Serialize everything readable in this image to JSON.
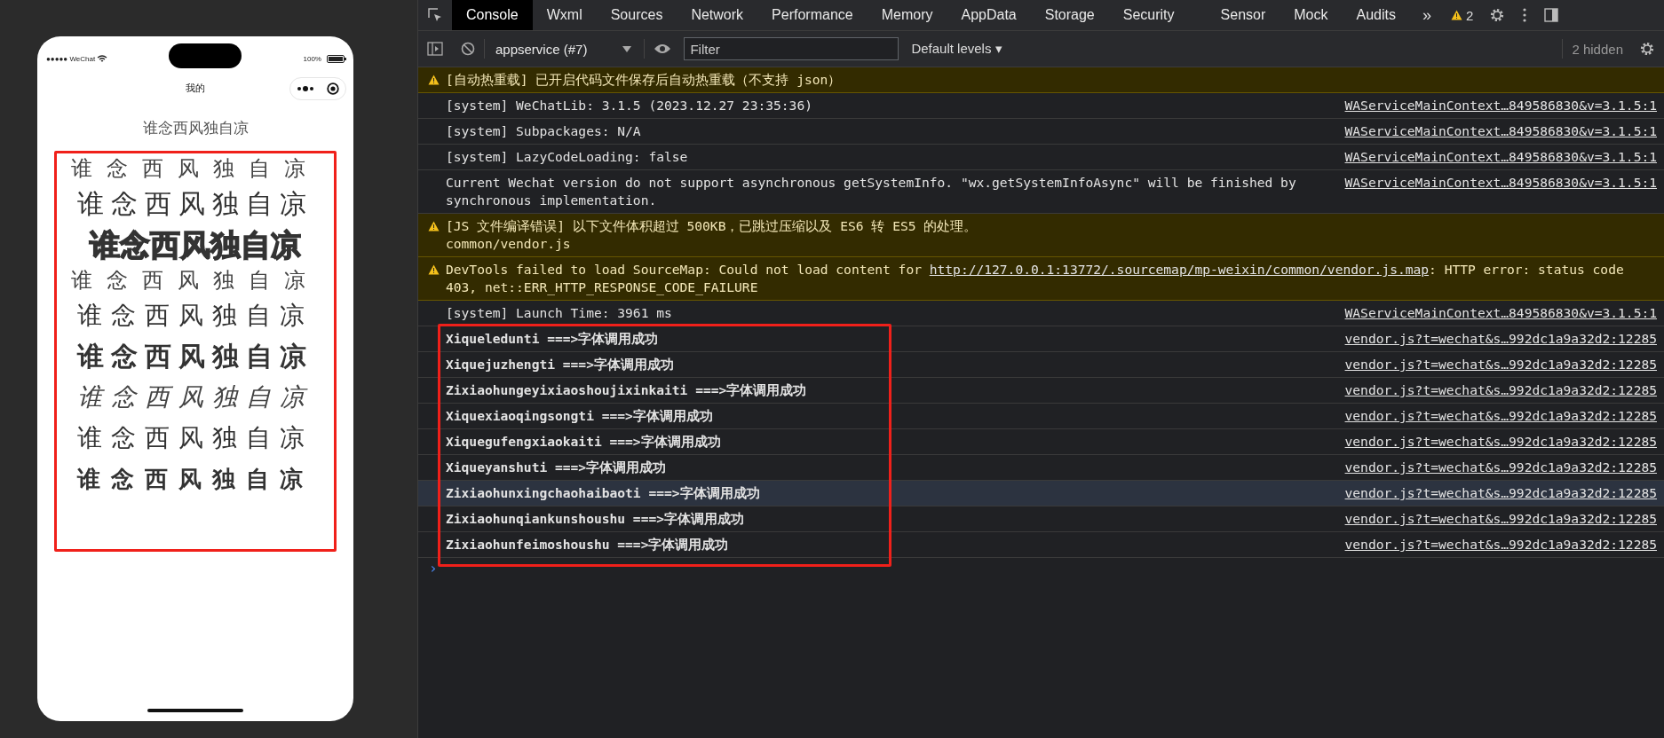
{
  "phone": {
    "status_bar": {
      "carrier": "●●●●● WeChat",
      "battery": "100%"
    },
    "nav_title": "我的",
    "page_title": "谁念西风独自凉",
    "samples": [
      {
        "text": "谁念西风独自凉",
        "kind": "thin"
      },
      {
        "text": "谁念西风独自凉",
        "kind": "song"
      },
      {
        "text": "谁念西风独自凉",
        "kind": "heavy"
      },
      {
        "text": "谁念西风独自凉",
        "kind": "thin"
      },
      {
        "text": "谁念西风独自凉",
        "kind": "kai"
      },
      {
        "text": "谁念西风独自凉",
        "kind": "brush"
      },
      {
        "text": "谁念西风独自凉",
        "kind": "script"
      },
      {
        "text": "谁念西风独自凉",
        "kind": "kai"
      },
      {
        "text": "谁念西风独自凉",
        "kind": "bold"
      }
    ]
  },
  "devtools": {
    "tabs": [
      {
        "label": "Console",
        "selected": true
      },
      {
        "label": "Wxml",
        "selected": false
      },
      {
        "label": "Sources",
        "selected": false
      },
      {
        "label": "Network",
        "selected": false
      },
      {
        "label": "Performance",
        "selected": false
      },
      {
        "label": "Memory",
        "selected": false
      },
      {
        "label": "AppData",
        "selected": false
      },
      {
        "label": "Storage",
        "selected": false
      },
      {
        "label": "Security",
        "selected": false
      },
      {
        "label": "Sensor",
        "selected": false
      },
      {
        "label": "Mock",
        "selected": false
      },
      {
        "label": "Audits",
        "selected": false
      }
    ],
    "more_tabs": "»",
    "warning_count": "2",
    "toolbar": {
      "context": "appservice (#7)",
      "filter_placeholder": "Filter",
      "levels": "Default levels ▾",
      "hidden": "2 hidden"
    },
    "entries": [
      {
        "kind": "warning",
        "highlighted": false,
        "text": "[自动热重载] 已开启代码文件保存后自动热重载（不支持 json）"
      },
      {
        "kind": "log",
        "highlighted": false,
        "text": "[system] WeChatLib: 3.1.5 (2023.12.27 23:35:36)",
        "source": "WAServiceMainContext…849586830&v=3.1.5:1"
      },
      {
        "kind": "log",
        "highlighted": false,
        "text": "[system] Subpackages: N/A",
        "source": "WAServiceMainContext…849586830&v=3.1.5:1"
      },
      {
        "kind": "log",
        "highlighted": false,
        "text": "[system] LazyCodeLoading: false",
        "source": "WAServiceMainContext…849586830&v=3.1.5:1"
      },
      {
        "kind": "log",
        "highlighted": false,
        "text": "Current Wechat version do not support asynchronous getSystemInfo. \"wx.getSystemInfoAsync\" will be finished by synchronous implementation.",
        "source": "WAServiceMainContext…849586830&v=3.1.5:1"
      },
      {
        "kind": "warning",
        "highlighted": false,
        "text": "[JS 文件编译错误] 以下文件体积超过 500KB，已跳过压缩以及 ES6 转 ES5 的处理。\ncommon/vendor.js"
      },
      {
        "kind": "warning",
        "highlighted": false,
        "text": "DevTools failed to load SourceMap: Could not load content for",
        "link": "http://127.0.0.1:13772/.sourcemap/mp-weixin/common/vendor.js.map",
        "text_after": ": HTTP error: status code 403, net::ERR_HTTP_RESPONSE_CODE_FAILURE"
      },
      {
        "kind": "log",
        "highlighted": false,
        "text": "[system] Launch Time: 3961 ms",
        "source": "WAServiceMainContext…849586830&v=3.1.5:1"
      }
    ],
    "font_logs": [
      {
        "text": "Xiqueledunti ===>字体调用成功",
        "highlighted": false,
        "source": "vendor.js?t=wechat&s…992dc1a9a32d2:12285"
      },
      {
        "text": "Xiquejuzhengti ===>字体调用成功",
        "highlighted": false,
        "source": "vendor.js?t=wechat&s…992dc1a9a32d2:12285"
      },
      {
        "text": "Zixiaohungeyixiaoshoujixinkaiti ===>字体调用成功",
        "highlighted": false,
        "source": "vendor.js?t=wechat&s…992dc1a9a32d2:12285"
      },
      {
        "text": "Xiquexiaoqingsongti ===>字体调用成功",
        "highlighted": false,
        "source": "vendor.js?t=wechat&s…992dc1a9a32d2:12285"
      },
      {
        "text": "Xiquegufengxiaokaiti ===>字体调用成功",
        "highlighted": false,
        "source": "vendor.js?t=wechat&s…992dc1a9a32d2:12285"
      },
      {
        "text": "Xiqueyanshuti ===>字体调用成功",
        "highlighted": false,
        "source": "vendor.js?t=wechat&s…992dc1a9a32d2:12285"
      },
      {
        "text": "Zixiaohunxingchaohaibaoti ===>字体调用成功",
        "highlighted": true,
        "source": "vendor.js?t=wechat&s…992dc1a9a32d2:12285"
      },
      {
        "text": "Zixiaohunqiankunshoushu ===>字体调用成功",
        "highlighted": false,
        "source": "vendor.js?t=wechat&s…992dc1a9a32d2:12285"
      },
      {
        "text": "Zixiaohunfeimoshoushu ===>字体调用成功",
        "highlighted": false,
        "source": "vendor.js?t=wechat&s…992dc1a9a32d2:12285"
      }
    ],
    "prompt": "›"
  }
}
